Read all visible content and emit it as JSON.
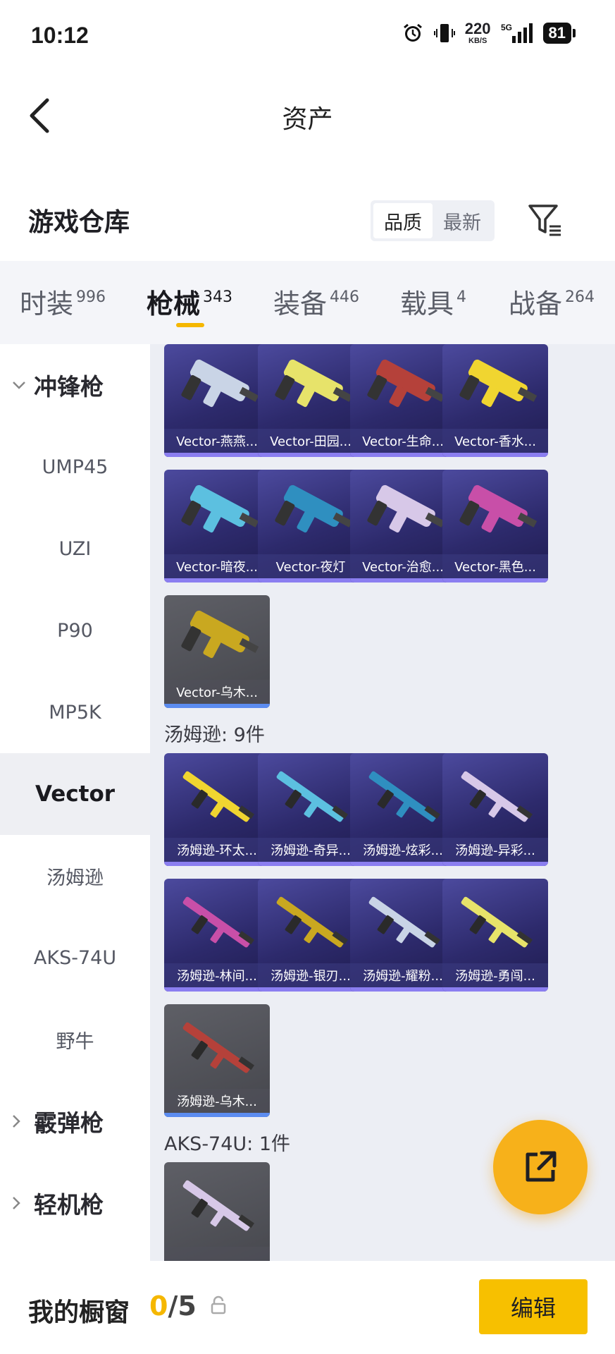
{
  "status_bar": {
    "time": "10:12",
    "net_speed": "220",
    "net_unit": "KB/S",
    "network": "5G",
    "battery": "81"
  },
  "header": {
    "title": "资产"
  },
  "warehouse": {
    "title": "游戏仓库",
    "sort_options": [
      "品质",
      "最新"
    ],
    "sort_selected": "品质"
  },
  "tabs": [
    {
      "label": "时装",
      "count": "996"
    },
    {
      "label": "枪械",
      "count": "343"
    },
    {
      "label": "装备",
      "count": "446"
    },
    {
      "label": "载具",
      "count": "4"
    },
    {
      "label": "战备",
      "count": "264"
    }
  ],
  "active_tab": "枪械",
  "sidebar": {
    "items": [
      {
        "label": "冲锋枪",
        "type": "group",
        "expanded": true
      },
      {
        "label": "UMP45",
        "type": "item"
      },
      {
        "label": "UZI",
        "type": "item"
      },
      {
        "label": "P90",
        "type": "item"
      },
      {
        "label": "MP5K",
        "type": "item"
      },
      {
        "label": "Vector",
        "type": "item",
        "active": true
      },
      {
        "label": "汤姆逊",
        "type": "item"
      },
      {
        "label": "AKS-74U",
        "type": "item"
      },
      {
        "label": "野牛",
        "type": "item"
      },
      {
        "label": "霰弹枪",
        "type": "group",
        "expanded": false
      },
      {
        "label": "轻机枪",
        "type": "group",
        "expanded": false
      }
    ]
  },
  "sections": [
    {
      "title": "",
      "items": [
        {
          "label": "Vector-燕燕...",
          "tier": "purple"
        },
        {
          "label": "Vector-田园...",
          "tier": "purple"
        },
        {
          "label": "Vector-生命...",
          "tier": "purple"
        },
        {
          "label": "Vector-香水...",
          "tier": "purple"
        },
        {
          "label": "Vector-暗夜...",
          "tier": "purple"
        },
        {
          "label": "Vector-夜灯",
          "tier": "purple"
        },
        {
          "label": "Vector-治愈...",
          "tier": "purple"
        },
        {
          "label": "Vector-黑色...",
          "tier": "purple"
        },
        {
          "label": "Vector-乌木...",
          "tier": "grey"
        }
      ]
    },
    {
      "title": "汤姆逊: 9件",
      "items": [
        {
          "label": "汤姆逊-环太...",
          "tier": "purple"
        },
        {
          "label": "汤姆逊-奇异...",
          "tier": "purple"
        },
        {
          "label": "汤姆逊-炫彩...",
          "tier": "purple"
        },
        {
          "label": "汤姆逊-异彩...",
          "tier": "purple"
        },
        {
          "label": "汤姆逊-林间...",
          "tier": "purple"
        },
        {
          "label": "汤姆逊-银刃...",
          "tier": "purple"
        },
        {
          "label": "汤姆逊-耀粉...",
          "tier": "purple"
        },
        {
          "label": "汤姆逊-勇闯...",
          "tier": "purple"
        },
        {
          "label": "汤姆逊-乌木...",
          "tier": "grey"
        }
      ]
    },
    {
      "title": "AKS-74U: 1件",
      "items": [
        {
          "label": "",
          "tier": "grey"
        }
      ]
    }
  ],
  "showcase": {
    "title": "我的橱窗",
    "current": "0",
    "separator": "/",
    "max": "5"
  },
  "edit_label": "编辑",
  "colors": {
    "accent": "#f5b700",
    "fab": "#f7b11a",
    "purple_card": "#3a3788",
    "grey_card": "#505158"
  }
}
